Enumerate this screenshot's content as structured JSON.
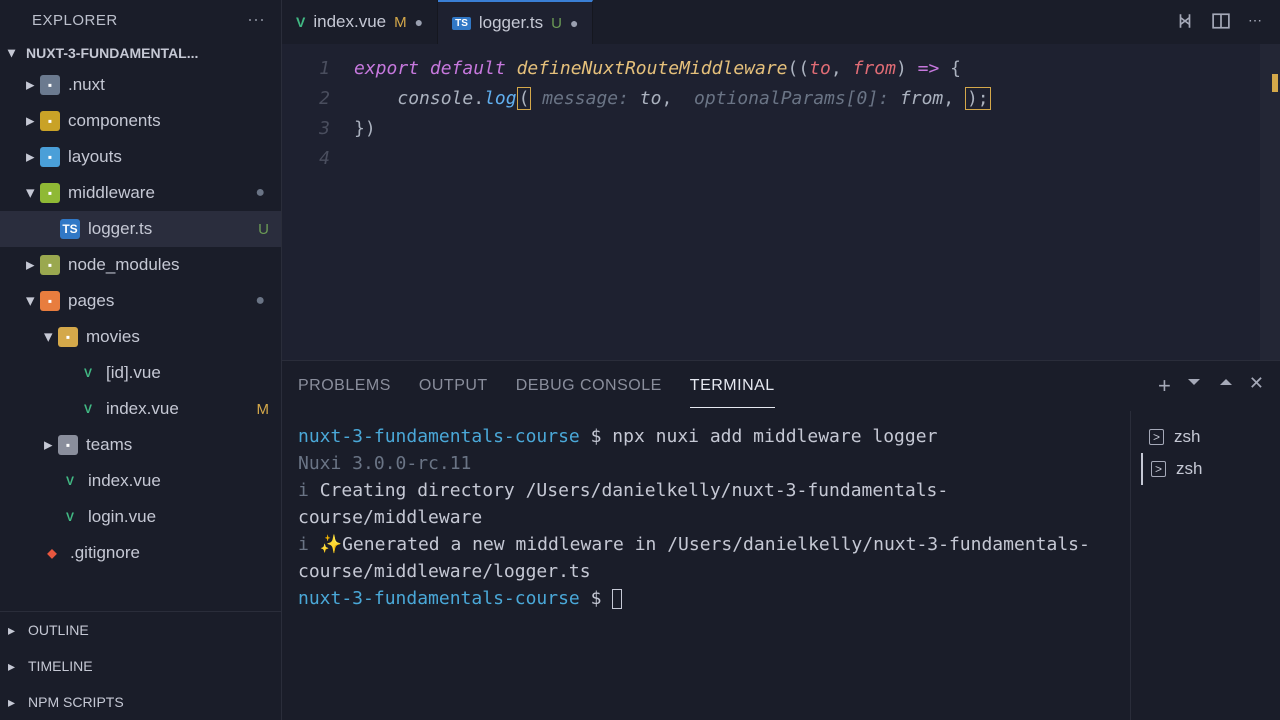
{
  "explorer": {
    "title": "EXPLORER",
    "project": "NUXT-3-FUNDAMENTAL..."
  },
  "tree": [
    {
      "indent": 1,
      "chev": "right",
      "icon": "folder-nuxt",
      "name": ".nuxt",
      "status": ""
    },
    {
      "indent": 1,
      "chev": "right",
      "icon": "folder-components",
      "name": "components",
      "status": ""
    },
    {
      "indent": 1,
      "chev": "right",
      "icon": "folder-layouts",
      "name": "layouts",
      "status": ""
    },
    {
      "indent": 1,
      "chev": "down",
      "icon": "folder-middleware",
      "name": "middleware",
      "status": "",
      "dot": true
    },
    {
      "indent": 2,
      "chev": "",
      "icon": "ts",
      "name": "logger.ts",
      "status": "U",
      "active": true
    },
    {
      "indent": 1,
      "chev": "right",
      "icon": "folder-node",
      "name": "node_modules",
      "status": ""
    },
    {
      "indent": 1,
      "chev": "down",
      "icon": "folder-pages",
      "name": "pages",
      "status": "",
      "dot": true
    },
    {
      "indent": 2,
      "chev": "down",
      "icon": "folder-movies",
      "name": "movies",
      "status": ""
    },
    {
      "indent": 3,
      "chev": "",
      "icon": "vue",
      "name": "[id].vue",
      "status": ""
    },
    {
      "indent": 3,
      "chev": "",
      "icon": "vue",
      "name": "index.vue",
      "status": "M"
    },
    {
      "indent": 2,
      "chev": "right",
      "icon": "folder-teams",
      "name": "teams",
      "status": ""
    },
    {
      "indent": 2,
      "chev": "",
      "icon": "vue",
      "name": "index.vue",
      "status": ""
    },
    {
      "indent": 2,
      "chev": "",
      "icon": "vue",
      "name": "login.vue",
      "status": ""
    },
    {
      "indent": 1,
      "chev": "",
      "icon": "git",
      "name": ".gitignore",
      "status": ""
    }
  ],
  "bottom_sections": [
    "OUTLINE",
    "TIMELINE",
    "NPM SCRIPTS"
  ],
  "tabs": [
    {
      "icon": "vue",
      "name": "index.vue",
      "status": "M",
      "dirty": true,
      "active": false
    },
    {
      "icon": "ts",
      "name": "logger.ts",
      "status": "U",
      "dirty": true,
      "active": true
    }
  ],
  "code": {
    "line_numbers": [
      "1",
      "2",
      "3",
      "4"
    ],
    "line1": {
      "export": "export",
      "default": "default",
      "fn": "defineNuxtRouteMiddleware",
      "open": "((",
      "to": "to",
      "comma": ", ",
      "from": "from",
      "close": ") ",
      "arrow": "=>",
      "brace": " {"
    },
    "line2": {
      "indent": "    ",
      "console": "console",
      "dot": ".",
      "log": "log",
      "open": "(",
      "hint1": " message: ",
      "to": "to",
      "comma1": ",  ",
      "hint2": "optionalParams[0]: ",
      "from": "from",
      "comma2": ", ",
      "close": ");"
    },
    "line3": "})"
  },
  "panel": {
    "tabs": [
      "PROBLEMS",
      "OUTPUT",
      "DEBUG CONSOLE",
      "TERMINAL"
    ],
    "active_tab": 3
  },
  "terminal": {
    "prompt": "nuxt-3-fundamentals-course",
    "dollar": "$",
    "cmd": "npx nuxi add middleware logger",
    "line2": "Nuxi 3.0.0-rc.11",
    "info_i": "i",
    "line3": "Creating directory /Users/danielkelly/nuxt-3-fundamentals-course/middleware",
    "line4": "Generated a new middleware in /Users/danielkelly/nuxt-3-fundamentals-course/middleware/logger.ts"
  },
  "shells": [
    {
      "name": "zsh"
    },
    {
      "name": "zsh",
      "active": true
    }
  ]
}
